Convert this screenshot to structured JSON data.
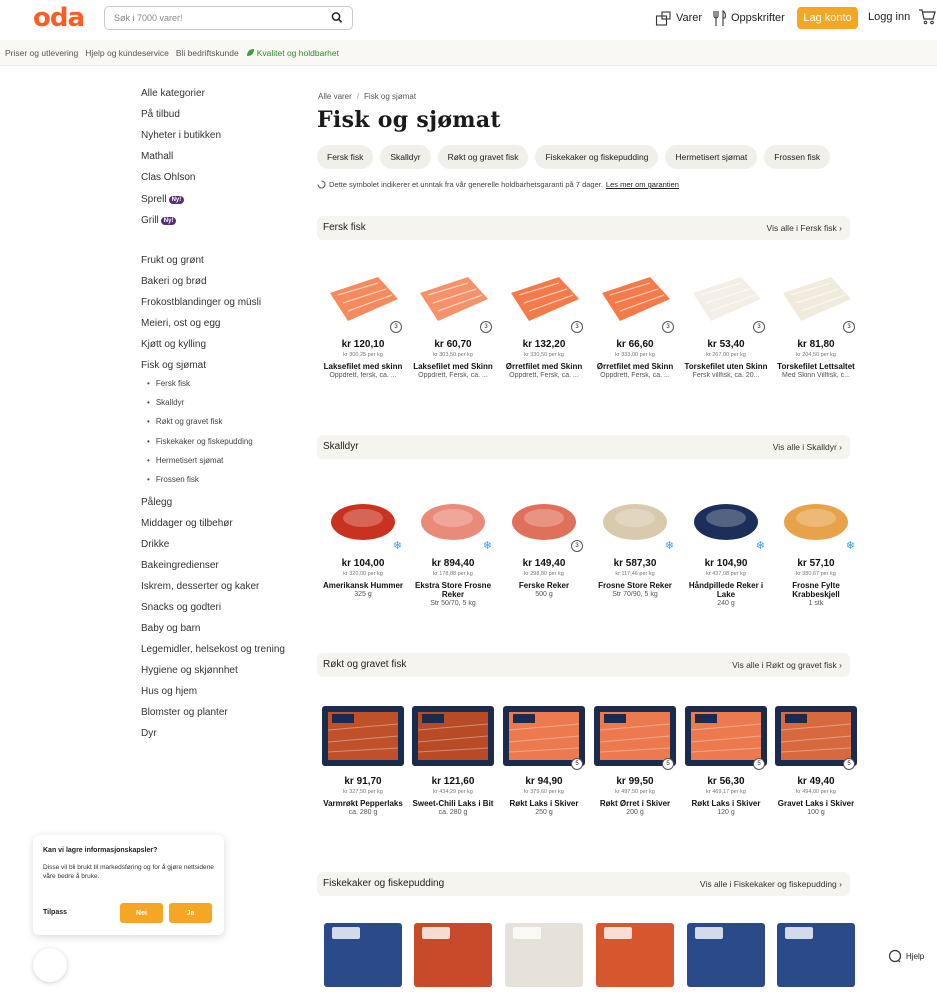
{
  "header": {
    "logo": "oda",
    "search_placeholder": "Søk i 7000 varer!",
    "nav_varer": "Varer",
    "nav_oppskrifter": "Oppskrifter",
    "lag_konto": "Lag konto",
    "logg_inn": "Logg inn",
    "accent": "#ff5b24",
    "button_color": "#f5a623"
  },
  "subnav": {
    "items": [
      "Priser og utlevering",
      "Hjelp og kundeservice",
      "Bli bedriftskunde"
    ],
    "green_item": "Kvalitet og holdbarhet"
  },
  "sidebar": {
    "items": [
      "Alle kategorier",
      "På tilbud",
      "Nyheter i butikken",
      "Mathall",
      "Clas Ohlson",
      "Sprell",
      "Grill",
      "Frukt og grønt",
      "Bakeri og brød",
      "Frokostblandinger og müsli",
      "Meieri, ost og egg",
      "Kjøtt og kylling",
      "Fisk og sjømat",
      "Pålegg",
      "Middager og tilbehør",
      "Drikke",
      "Bakeingredienser",
      "Iskrem, desserter og kaker",
      "Snacks og godteri",
      "Baby og barn",
      "Legemidler, helsekost og trening",
      "Hygiene og skjønnhet",
      "Hus og hjem",
      "Blomster og planter",
      "Dyr"
    ],
    "badge": "Ny!",
    "subitems": [
      "Fersk fisk",
      "Skalldyr",
      "Røkt og gravet fisk",
      "Fiskekaker og fiskepudding",
      "Hermetisert sjømat",
      "Frossen fisk"
    ]
  },
  "main": {
    "breadcrumb_root": "Alle varer",
    "breadcrumb_sep": "/",
    "breadcrumb_current": "Fisk og sjømat",
    "title": "Fisk og sjømat",
    "chips": [
      "Fersk fisk",
      "Skalldyr",
      "Røkt og gravet fisk",
      "Fiskekaker og fiskepudding",
      "Hermetisert sjømat",
      "Frossen fisk"
    ],
    "note": "Dette symbolet indikerer et unntak fra vår generelle holdbarhetsgaranti på 7 dager.",
    "note_link": "Les mer om garantien"
  },
  "sections": [
    {
      "title": "Fersk fisk",
      "view_all": "Vis alle i Fersk fisk",
      "products": [
        {
          "price": "kr 120,10",
          "unit": "kr 300,25 per kg",
          "name": "Laksefilet med skinn",
          "desc": "Oppdrett, fersk, ca. ...",
          "badge": "3",
          "color": "#f58a5c"
        },
        {
          "price": "kr 60,70",
          "unit": "kr 303,50 per kg",
          "name": "Laksefilet med Skinn",
          "desc": "Oppdrett, Fersk, ca. ...",
          "badge": "3",
          "color": "#f7916a"
        },
        {
          "price": "kr 132,20",
          "unit": "kr 330,50 per kg",
          "name": "Ørretfilet med Skinn",
          "desc": "Oppdrett, Fersk, ca. ...",
          "badge": "3",
          "color": "#f47a4a"
        },
        {
          "price": "kr 66,60",
          "unit": "kr 333,00 per kg",
          "name": "Ørretfilet med Skinn",
          "desc": "Oppdrett, Fersk, ca. ...",
          "badge": "3",
          "color": "#f47a4a"
        },
        {
          "price": "kr 53,40",
          "unit": "kr 267,00 per kg",
          "name": "Torskefilet uten Skinn",
          "desc": "Fersk villfisk, ca. 20...",
          "badge": "3",
          "color": "#f3efe6"
        },
        {
          "price": "kr 81,80",
          "unit": "kr 204,50 per kg",
          "name": "Torskefilet Lettsaltet",
          "desc": "Med Skinn Villfisk, c...",
          "badge": "3",
          "color": "#f0ebdd"
        }
      ]
    },
    {
      "title": "Skalldyr",
      "view_all": "Vis alle i Skalldyr",
      "products": [
        {
          "price": "kr 104,00",
          "unit": "kr 320,00 per kg",
          "name": "Amerikansk Hummer",
          "desc": "325 g",
          "badge": "snow",
          "color": "#c8321e"
        },
        {
          "price": "kr 894,40",
          "unit": "kr 178,88 per kg",
          "name": "Ekstra Store Frosne Reker",
          "desc": "Str 50/70, 5 kg",
          "badge": "snow",
          "color": "#ea8a78"
        },
        {
          "price": "kr 149,40",
          "unit": "kr 298,80 per kg",
          "name": "Ferske Reker",
          "desc": "500 g",
          "badge": "3",
          "color": "#e0705a"
        },
        {
          "price": "kr 587,30",
          "unit": "kr 117,46 per kg",
          "name": "Frosne Store Reker",
          "desc": "Str 70/90, 5 kg",
          "badge": "snow",
          "color": "#d9c9ad"
        },
        {
          "price": "kr 104,90",
          "unit": "kr 437,08 per kg",
          "name": "Håndpillede Reker i Lake",
          "desc": "240 g",
          "badge": "snow",
          "color": "#1c2f5a"
        },
        {
          "price": "kr 57,10",
          "unit": "kr 380,67 per kg",
          "name": "Frosne Fylte Krabbeskjell",
          "desc": "1 stk",
          "badge": "snow",
          "color": "#e8a24a"
        }
      ]
    },
    {
      "title": "Røkt og gravet fisk",
      "view_all": "Vis alle i Røkt og gravet fisk",
      "products": [
        {
          "price": "kr 91,70",
          "unit": "kr 327,50 per kg",
          "name": "Varmrøkt Pepperlaks",
          "desc": "ca. 280 g",
          "badge": "",
          "color": "#c0502a"
        },
        {
          "price": "kr 121,60",
          "unit": "kr 434,29 per kg",
          "name": "Sweet-Chili Laks i Bit",
          "desc": "ca. 280 g",
          "badge": "",
          "color": "#b84a26"
        },
        {
          "price": "kr 94,90",
          "unit": "kr 379,60 per kg",
          "name": "Røkt Laks i Skiver",
          "desc": "250 g",
          "badge": "5",
          "color": "#ec7a4e"
        },
        {
          "price": "kr 99,50",
          "unit": "kr 497,50 per kg",
          "name": "Røkt Ørret i Skiver",
          "desc": "200 g",
          "badge": "5",
          "color": "#ec7a4e"
        },
        {
          "price": "kr 56,30",
          "unit": "kr 469,17 per kg",
          "name": "Røkt Laks i Skiver",
          "desc": "120 g",
          "badge": "5",
          "color": "#ec7a4e"
        },
        {
          "price": "kr 49,40",
          "unit": "kr 494,00 per kg",
          "name": "Gravet Laks i Skiver",
          "desc": "100 g",
          "badge": "5",
          "color": "#d8693e"
        }
      ]
    },
    {
      "title": "Fiskekaker og fiskepudding",
      "view_all": "Vis alle i Fiskekaker og fiskepudding",
      "products": [
        {
          "color": "#2a4a8a"
        },
        {
          "color": "#c84a2a"
        },
        {
          "color": "#e6e2da"
        },
        {
          "color": "#d6562e"
        },
        {
          "color": "#2a4a8a"
        },
        {
          "color": "#2a4a8a"
        }
      ]
    }
  ],
  "cookie": {
    "title": "Kan vi lagre informasjonskapsler?",
    "text": "Disse vil bli brukt til markedsføring og for å gjøre nettsidene våre bedre å bruke.",
    "tilpass": "Tilpass",
    "nei": "Nei",
    "ja": "Ja"
  },
  "help": "Hjelp"
}
